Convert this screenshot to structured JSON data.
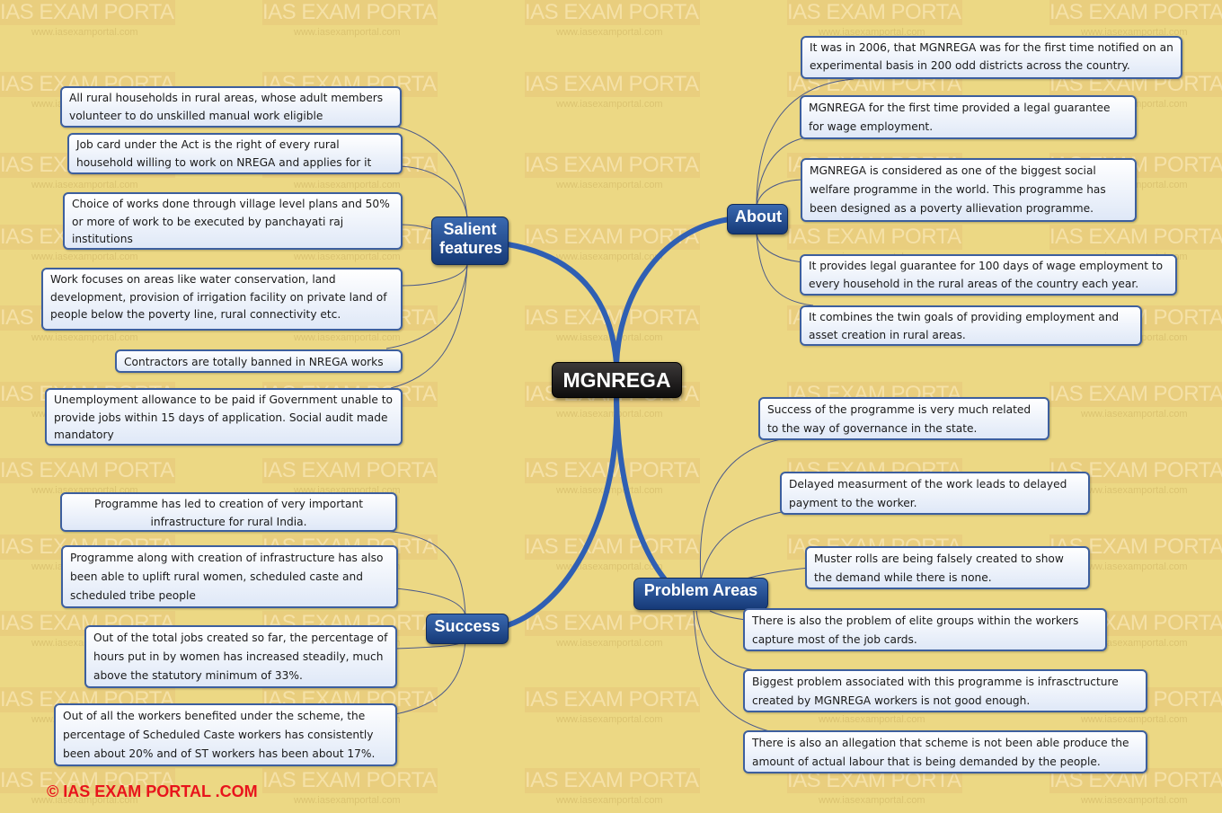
{
  "central": {
    "label": "MGNREGA"
  },
  "watermark": {
    "title": "IAS EXAM PORTAL",
    "url": "www.iasexamportal.com"
  },
  "branches": {
    "salient": {
      "label_line1": "Salient",
      "label_line2": "features",
      "items": [
        "All rural households in rural areas, whose adult members volunteer to do unskilled manual work eligible",
        "Job card under the Act is the right of every rural household willing to work on NREGA and applies for it",
        "Choice of works done through village level plans and 50% or more of work to be executed by panchayati raj institutions",
        "Work focuses on areas like water conservation, land development, provision of irrigation facility on private land of people below the poverty line, rural connectivity etc.",
        "Contractors are totally banned in NREGA works",
        "Unemployment allowance to be paid if Government unable to provide jobs within 15 days of application. Social audit made mandatory"
      ]
    },
    "about": {
      "label": "About",
      "items": [
        "It was in 2006, that MGNREGA was for the first time notified on an experimental basis in 200 odd districts across the country.",
        "MGNREGA for the first time provided a legal guarantee for wage employment.",
        "MGNREGA is considered as one of the biggest social welfare programme in the world. This programme has been designed as a poverty allievation programme.",
        "It provides legal guarantee for 100 days of wage employment to every household in the rural areas of the country each year.",
        "It combines the twin goals of providing employment and asset creation in rural areas."
      ]
    },
    "success": {
      "label": "Success",
      "items": [
        "Programme has led to creation of very important infrastructure for rural India.",
        "Programme along with creation of infrastructure has also been able to uplift rural women, scheduled caste and scheduled tribe people",
        "Out of the total jobs created so far, the percentage of hours put in by women has increased steadily, much above the statutory minimum of 33%.",
        "Out of all the workers benefited under the scheme, the percentage of Scheduled Caste workers has consistently been about 20% and of ST workers has been about 17%."
      ]
    },
    "problems": {
      "label": "Problem Areas",
      "items": [
        "Success of the programme is very much related to the way of governance in the state.",
        "Delayed measurment of the work leads to delayed payment to the worker.",
        "Muster rolls are being falsely created to show the demand while there is none.",
        "There is also the problem of elite groups within the workers capture most of the job cards.",
        "Biggest problem associated with this programme is infrasctructure created by MGNREGA workers is not good enough.",
        "There is also an allegation that scheme is not been able produce the amount of actual labour that is being demanded by the people."
      ]
    }
  },
  "footer": {
    "copyright": "© IAS EXAM PORTAL .COM"
  },
  "colors": {
    "background": "#ecd884",
    "branch": "#2f5fb3",
    "topic": "#1f4a8f",
    "copyright": "#e8141c"
  }
}
